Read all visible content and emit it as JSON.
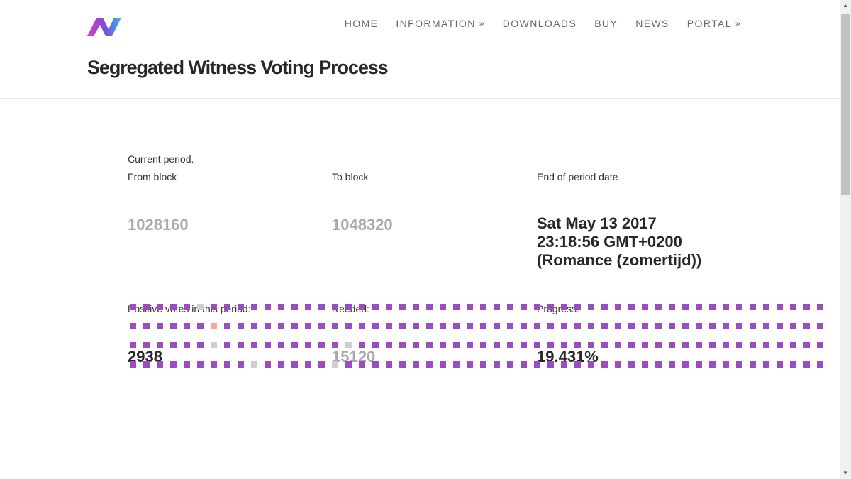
{
  "header": {
    "nav": [
      {
        "label": "HOME",
        "has_dropdown": false
      },
      {
        "label": "INFORMATION",
        "has_dropdown": true
      },
      {
        "label": "DOWNLOADS",
        "has_dropdown": false
      },
      {
        "label": "BUY",
        "has_dropdown": false
      },
      {
        "label": "NEWS",
        "has_dropdown": false
      },
      {
        "label": "PORTAL",
        "has_dropdown": true
      }
    ],
    "page_title": "Segregated Witness Voting Process"
  },
  "period": {
    "current_label": "Current period.",
    "from_label": "From block",
    "from_value": "1028160",
    "to_label": "To block",
    "to_value": "1048320",
    "end_label": "End of period date",
    "end_value": "Sat May 13 2017 23:18:56 GMT+0200 (Romance (zomertijd))"
  },
  "votes": {
    "positive_label": "Positive votes in this period:",
    "positive_value": "2938",
    "needed_label": "Needed:",
    "needed_value": "15120",
    "progress_label": "Progress:",
    "progress_value": "19.431%"
  },
  "block_grid": {
    "colors": {
      "v": "#9b4dbf",
      "g": "#cfcfcf",
      "o": "#f4a98a"
    },
    "rows": [
      "vvvvvgvvvvvvvvvvvvvvvvvvvvvvvvvvvvvvvvvvvvvvvvvvvvvv",
      "vvvvvvovvvvvvvvvvvvvvvvvvvvvvvvvvvvvvvvvvvvvvvvvvvvv",
      "vvvvvvgvvvvvvvvvgvvvvvvvvvvvvvvvvvvvvvvvvvvvvvvvvvvv",
      "vvvvvvvvvgvvvvvgvvvvvvvvvvvvvvvvvvvvvvvvvvvvvvvvvvvv"
    ]
  },
  "scrollbar": {
    "position": 0.0
  }
}
